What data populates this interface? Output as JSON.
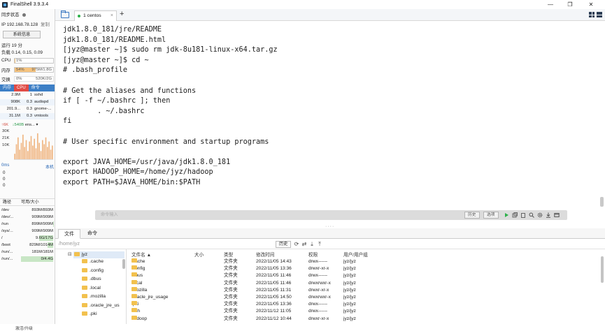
{
  "window": {
    "title": "FinalShell 3.9.3.4",
    "minimize": "—",
    "maximize": "❐",
    "close": "✕"
  },
  "sidebar": {
    "sync_label": "同步状态",
    "ip": "IP 192.168.78.128",
    "copy": "复制",
    "sysinfo_button": "系统信息",
    "uptime": "运行 19 分",
    "load": "负载 0.14, 0.15, 0.09",
    "cpu": {
      "label": "CPU",
      "value": "1%",
      "fraction": 0.01
    },
    "mem": {
      "label": "内存",
      "percent": "54%",
      "value": "975M/1.8G",
      "fraction": 0.54
    },
    "swap": {
      "label": "交换",
      "percent": "0%",
      "value": "520K/2G",
      "fraction": 0.0
    },
    "proc_tabs": [
      "内存",
      "CPU",
      "命令"
    ],
    "processes": [
      {
        "mem": "2.9M",
        "cpu": "1",
        "name": "sshd"
      },
      {
        "mem": "908K",
        "cpu": "0.3",
        "name": "audispd"
      },
      {
        "mem": "201.9...",
        "cpu": "0.3",
        "name": "gnome-..."
      },
      {
        "mem": "31.1M",
        "cpu": "0.3",
        "name": "vmtools"
      }
    ],
    "net": {
      "up": "↑6K",
      "down": "↓540B",
      "iface": "ens...",
      "axis": [
        "30K",
        "21K",
        "10K"
      ],
      "bars": [
        0.2,
        0.55,
        0.8,
        0.35,
        0.6,
        0.9,
        0.45,
        0.7,
        0.3,
        0.65,
        0.85,
        0.5,
        0.75,
        0.4,
        0.95,
        0.6,
        0.3,
        0.7,
        0.55,
        0.8,
        0.45,
        0.65,
        0.35,
        0.5
      ]
    },
    "latency": {
      "value": "0ms",
      "host": "本机",
      "rows": [
        "0",
        "0",
        "0"
      ]
    },
    "disk_header": {
      "path": "路径",
      "size": "可用/大小"
    },
    "disks": [
      {
        "path": "/dev",
        "size": "893M/893M",
        "used": 0.0
      },
      {
        "path": "/dev/...",
        "size": "909M/909M",
        "used": 0.0
      },
      {
        "path": "/run",
        "size": "899M/909M",
        "used": 0.01
      },
      {
        "path": "/sys/...",
        "size": "909M/909M",
        "used": 0.0
      },
      {
        "path": "/",
        "size": "9.6G/17G",
        "used": 0.44
      },
      {
        "path": "/boot",
        "size": "829M/1014M",
        "used": 0.18
      },
      {
        "path": "/run/...",
        "size": "181M/181M",
        "used": 0.0
      },
      {
        "path": "/run/...",
        "size": "0/4.4G",
        "used": 1.0
      }
    ],
    "activate": "激活/升级"
  },
  "tabs": {
    "session_label": "1 centos",
    "close": "×",
    "add": "+"
  },
  "terminal": {
    "lines": [
      "jdk1.8.0_181/jre/README",
      "jdk1.8.0_181/README.html",
      "[jyz@master ~]$ sudo rm jdk-8u181-linux-x64.tar.gz",
      "[jyz@master ~]$ cd ~",
      "# .bash_profile",
      "",
      "# Get the aliases and functions",
      "if [ -f ~/.bashrc ]; then",
      "        . ~/.bashrc",
      "fi",
      "",
      "# User specific environment and startup programs",
      "",
      "export JAVA_HOME=/usr/java/jdk1.8.0_181",
      "export HADOOP_HOME=/home/jyz/hadoop",
      "export PATH=$JAVA_HOME/bin:$PATH"
    ],
    "cmd_placeholder": "命令输入",
    "history_button": "历史",
    "options_button": "选项"
  },
  "file_panel": {
    "tabs": [
      "文件",
      "命令"
    ],
    "path": "/home/jyz",
    "history_button": "历史",
    "tree_root": "jyz",
    "tree_items": [
      ".cache",
      ".config",
      ".dbus",
      ".local",
      ".mozilla",
      ".oracle_jre_us",
      ".pki"
    ],
    "columns": {
      "name": "文件名 ▲",
      "size": "大小",
      "type": "类型",
      "time": "修改时间",
      "perm": "权限",
      "owner": "用户/用户组"
    },
    "rows": [
      {
        "name": ".cache",
        "size": "",
        "type": "文件夹",
        "time": "2022/11/05 14:43",
        "perm": "drwx------",
        "owner": "jyz/jyz"
      },
      {
        "name": ".config",
        "size": "",
        "type": "文件夹",
        "time": "2022/11/05 13:36",
        "perm": "drwxr-xr-x",
        "owner": "jyz/jyz"
      },
      {
        "name": ".dbus",
        "size": "",
        "type": "文件夹",
        "time": "2022/11/05 11:46",
        "perm": "drwx------",
        "owner": "jyz/jyz"
      },
      {
        "name": ".local",
        "size": "",
        "type": "文件夹",
        "time": "2022/11/05 11:46",
        "perm": "drwxrwxr-x",
        "owner": "jyz/jyz"
      },
      {
        "name": ".mozilla",
        "size": "",
        "type": "文件夹",
        "time": "2022/11/05 11:31",
        "perm": "drwxr-xr-x",
        "owner": "jyz/jyz"
      },
      {
        "name": ".oracle_jre_usage",
        "size": "",
        "type": "文件夹",
        "time": "2022/11/05 14:50",
        "perm": "drwxrwxr-x",
        "owner": "jyz/jyz"
      },
      {
        "name": ".pki",
        "size": "",
        "type": "文件夹",
        "time": "2022/11/05 13:36",
        "perm": "drwx------",
        "owner": "jyz/jyz"
      },
      {
        "name": ".ssh",
        "size": "",
        "type": "文件夹",
        "time": "2022/11/12 11:05",
        "perm": "drwx------",
        "owner": "jyz/jyz"
      },
      {
        "name": "hadoop",
        "size": "",
        "type": "文件夹",
        "time": "2022/11/12 10:44",
        "perm": "drwxr-xr-x",
        "owner": "jyz/jyz"
      }
    ]
  },
  "colors": {
    "accent": "#3d7fc6",
    "cpu_tab": "#e14b45",
    "mem_fill": "#f6c37e",
    "disk_fill": "#c8e6c5",
    "session_dot": "#2db14b",
    "net_bar": "#f0b886"
  }
}
